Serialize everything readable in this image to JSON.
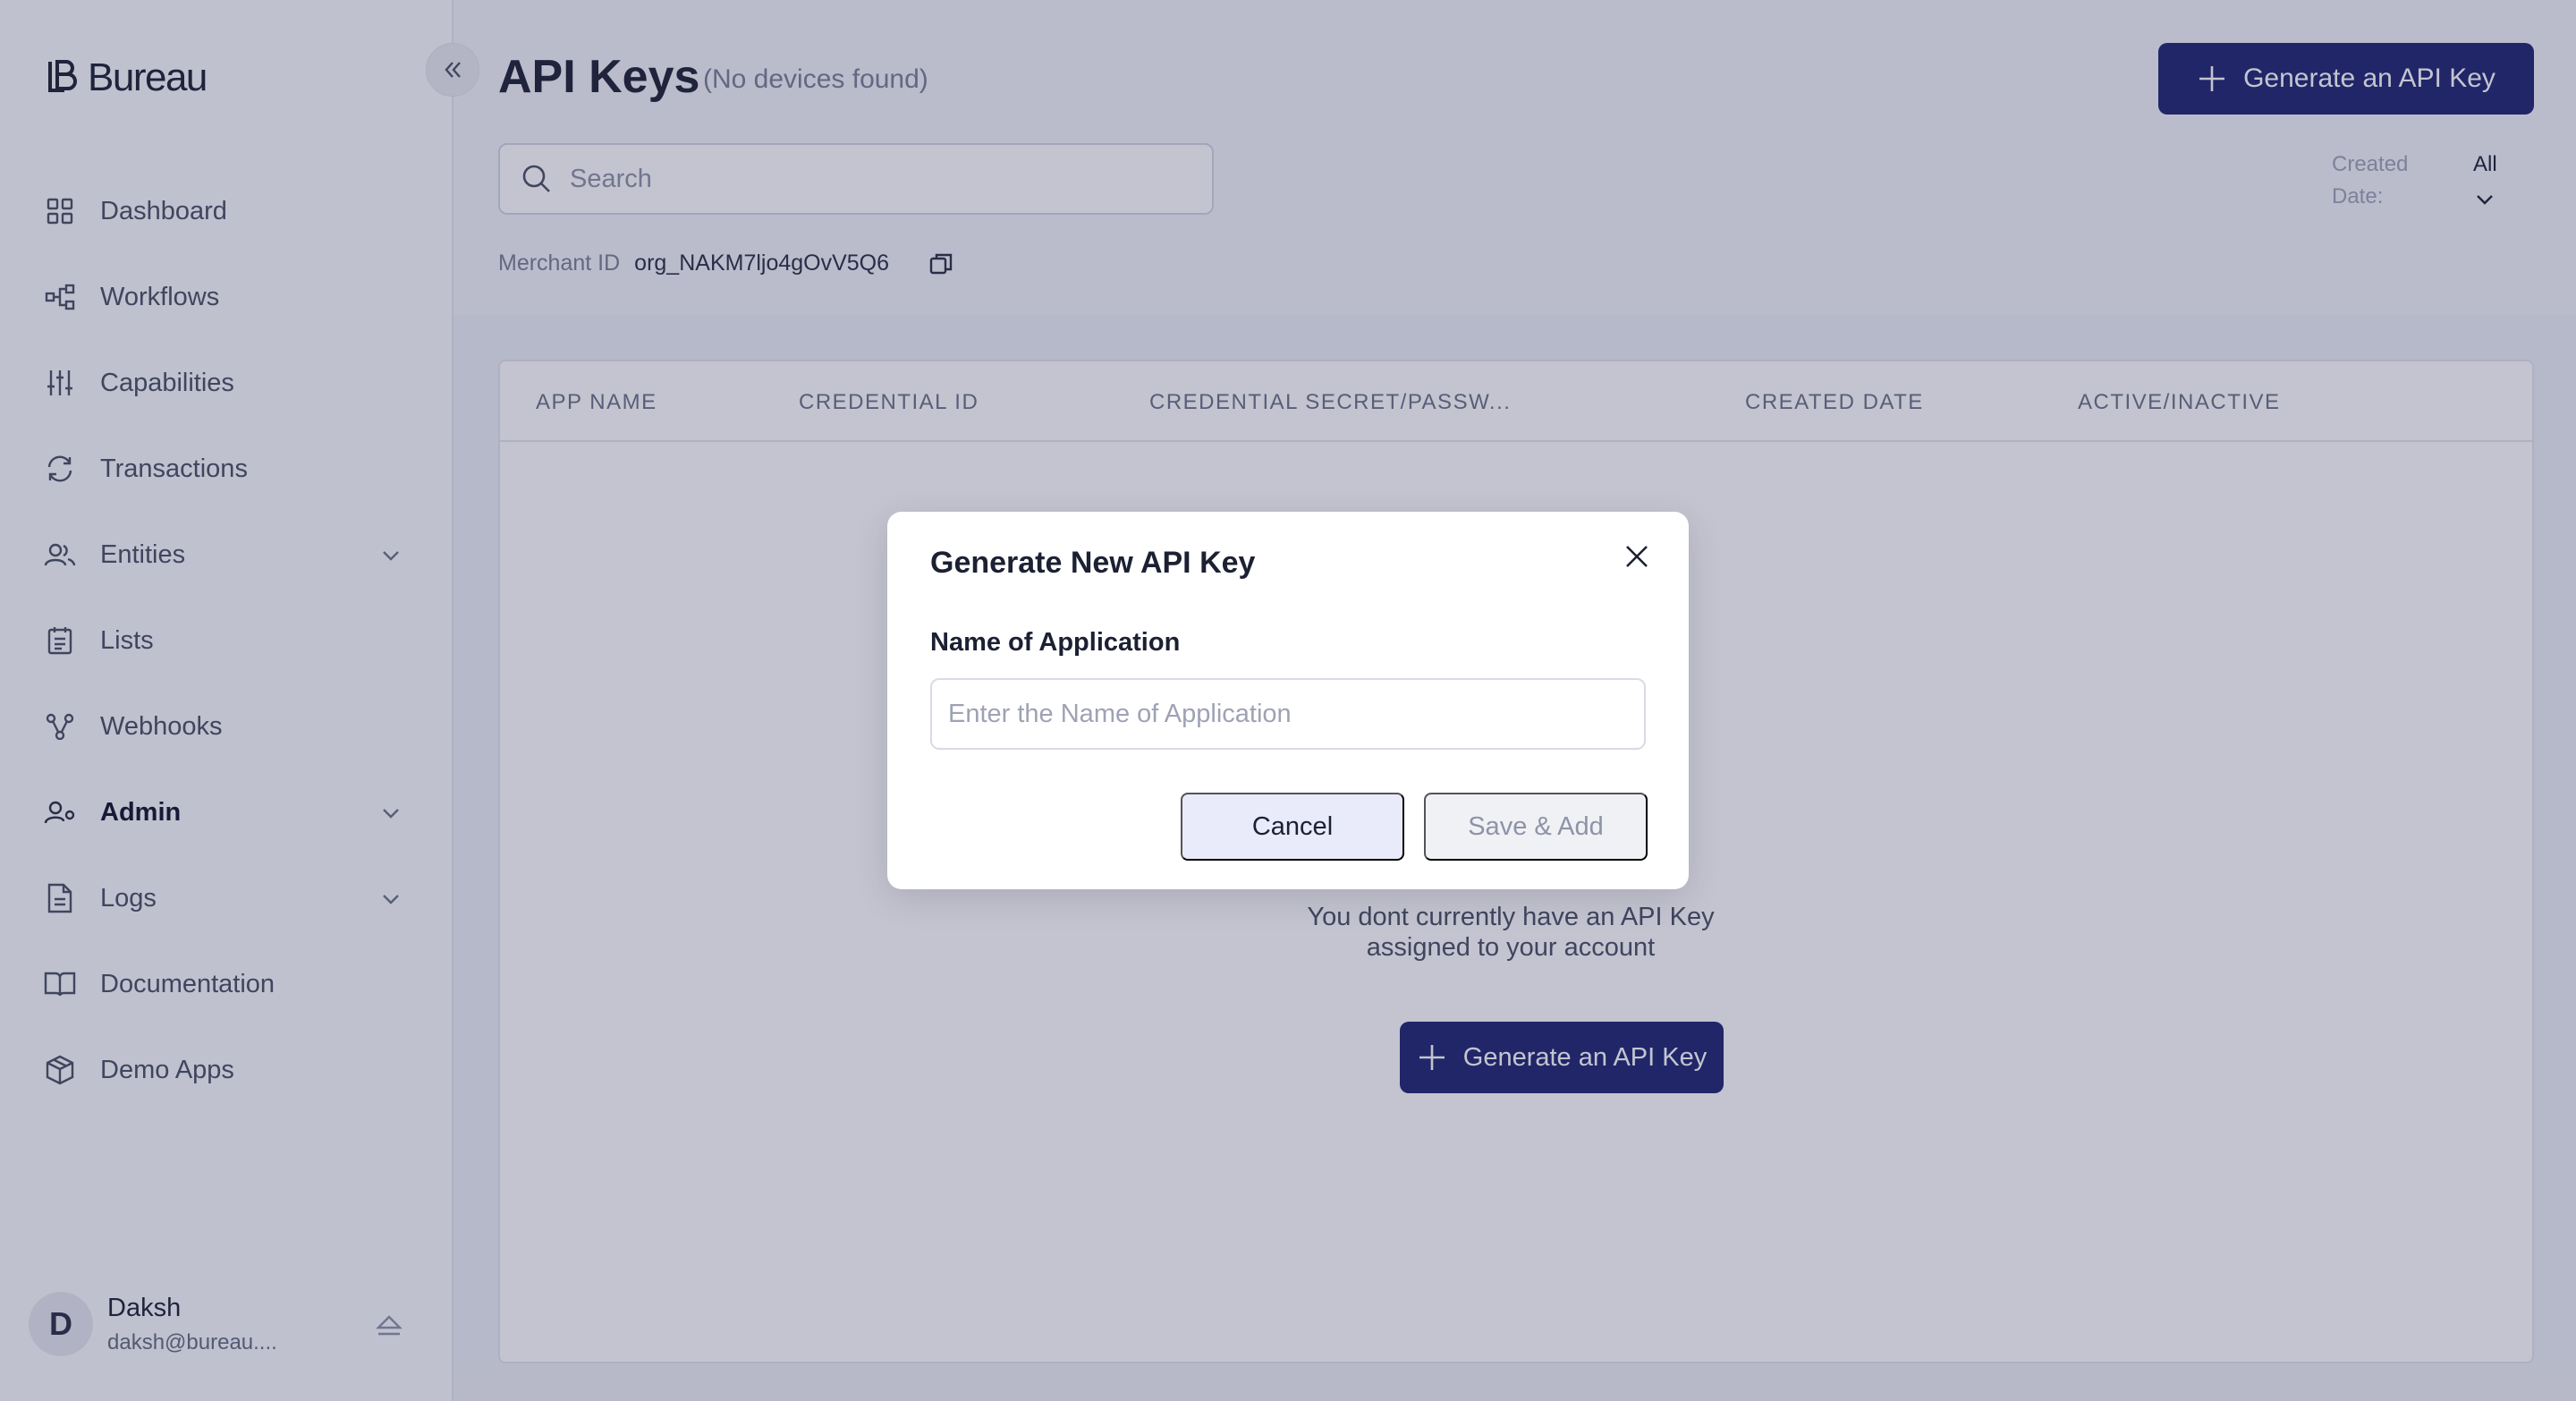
{
  "brand": {
    "name": "Bureau"
  },
  "sidebar": {
    "items": [
      {
        "label": "Dashboard",
        "icon": "grid-icon"
      },
      {
        "label": "Workflows",
        "icon": "workflow-icon"
      },
      {
        "label": "Capabilities",
        "icon": "sliders-icon"
      },
      {
        "label": "Transactions",
        "icon": "refresh-icon"
      },
      {
        "label": "Entities",
        "icon": "users-icon",
        "expandable": true
      },
      {
        "label": "Lists",
        "icon": "list-icon"
      },
      {
        "label": "Webhooks",
        "icon": "webhook-icon"
      },
      {
        "label": "Admin",
        "icon": "admin-icon",
        "expandable": true,
        "active": true
      },
      {
        "label": "Logs",
        "icon": "file-icon",
        "expandable": true
      },
      {
        "label": "Documentation",
        "icon": "book-icon"
      },
      {
        "label": "Demo Apps",
        "icon": "box-icon"
      }
    ],
    "user": {
      "initial": "D",
      "name": "Daksh",
      "email": "daksh@bureau...."
    }
  },
  "header": {
    "title": "API Keys",
    "subtitle": "(No devices found)",
    "generate_label": "Generate an API Key"
  },
  "search": {
    "placeholder": "Search"
  },
  "filter": {
    "label": "Created Date:",
    "value": "All"
  },
  "merchant": {
    "label": "Merchant ID",
    "value": "org_NAKM7ljo4gOvV5Q6"
  },
  "table": {
    "columns": [
      "APP NAME",
      "CREDENTIAL ID",
      "CREDENTIAL SECRET/PASSW...",
      "CREATED DATE",
      "ACTIVE/INACTIVE"
    ],
    "empty_message": "You dont currently have an API Key assigned to your account",
    "empty_button_label": "Generate an API Key"
  },
  "modal": {
    "title": "Generate New API Key",
    "field_label": "Name of Application",
    "field_placeholder": "Enter the Name of Application",
    "field_value": "",
    "cancel_label": "Cancel",
    "save_label": "Save & Add"
  },
  "colors": {
    "primary": "#1e2470",
    "overlay": "rgba(40,44,86,0.28)",
    "cancel_bg": "#e9ebfb",
    "save_disabled_bg": "#f0f1f5"
  }
}
